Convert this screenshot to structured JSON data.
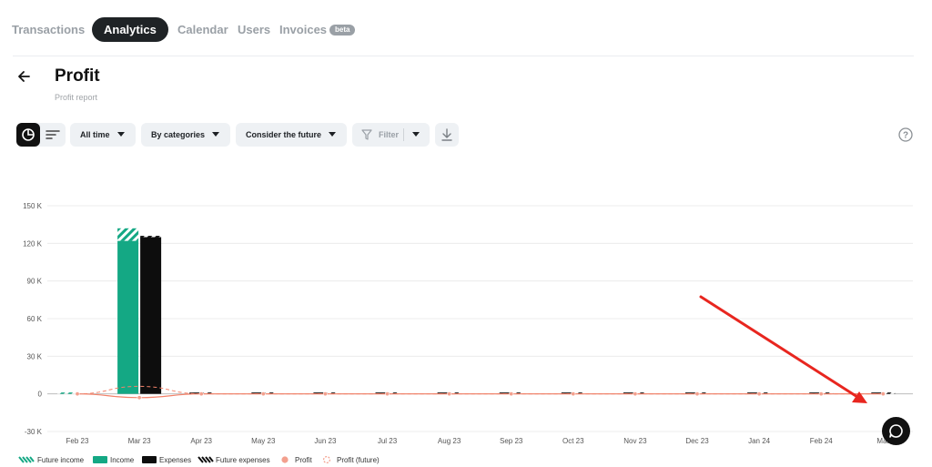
{
  "nav": {
    "tabs": [
      {
        "label": "Transactions"
      },
      {
        "label": "Analytics"
      },
      {
        "label": "Calendar"
      },
      {
        "label": "Users"
      },
      {
        "label": "Invoices"
      }
    ],
    "beta_badge": "beta"
  },
  "header": {
    "title": "Profit",
    "subtitle": "Profit report"
  },
  "toolbar": {
    "period": "All time",
    "grouping": "By categories",
    "future": "Consider the future",
    "filter": "Filter"
  },
  "colors": {
    "income": "#14a884",
    "expenses": "#0d0d0d",
    "profit": "#f3826a",
    "grid": "#ececec",
    "annotation_arrow": "#e8261f"
  },
  "chart_data": {
    "type": "bar",
    "categories": [
      "Feb 23",
      "Mar 23",
      "Apr 23",
      "May 23",
      "Jun 23",
      "Jul 23",
      "Aug 23",
      "Sep 23",
      "Oct 23",
      "Nov 23",
      "Dec 23",
      "Jan 24",
      "Feb 24",
      "Mar 24"
    ],
    "tick_labels": [
      "Feb 23",
      "Mar 23",
      "Apr 23",
      "May 23",
      "Jun 23",
      "Jul 23",
      "Aug 23",
      "Sep 23",
      "Oct 23",
      "Nov 23",
      "Dec 23",
      "Jan 24",
      "Feb 24",
      "Mar"
    ],
    "y_ticks": [
      -30000,
      0,
      30000,
      60000,
      90000,
      120000,
      150000
    ],
    "y_tick_labels": [
      "-30 K",
      "0",
      "30 K",
      "60 K",
      "90 K",
      "120 K",
      "150 K"
    ],
    "ylim": [
      -30000,
      150000
    ],
    "grid": true,
    "legend_position": "bottom-left",
    "series": [
      {
        "name": "Future income",
        "values": [
          0,
          10000,
          0,
          0,
          0,
          0,
          0,
          0,
          0,
          0,
          0,
          0,
          0,
          0
        ]
      },
      {
        "name": "Income",
        "values": [
          0,
          122000,
          0,
          0,
          0,
          0,
          0,
          0,
          0,
          0,
          0,
          0,
          0,
          0
        ]
      },
      {
        "name": "Expenses",
        "values": [
          0,
          125000,
          0,
          0,
          0,
          0,
          0,
          0,
          0,
          0,
          0,
          0,
          0,
          0
        ]
      },
      {
        "name": "Future expenses",
        "values": [
          0,
          1000,
          0,
          0,
          0,
          0,
          0,
          0,
          0,
          0,
          0,
          0,
          0,
          0
        ]
      },
      {
        "name": "Profit",
        "values": [
          0,
          -3000,
          0,
          0,
          0,
          0,
          0,
          0,
          0,
          0,
          0,
          0,
          0,
          0
        ]
      },
      {
        "name": "Profit (future)",
        "values": [
          0,
          6000,
          0,
          0,
          0,
          0,
          0,
          0,
          0,
          0,
          0,
          0,
          0,
          0
        ]
      }
    ]
  }
}
